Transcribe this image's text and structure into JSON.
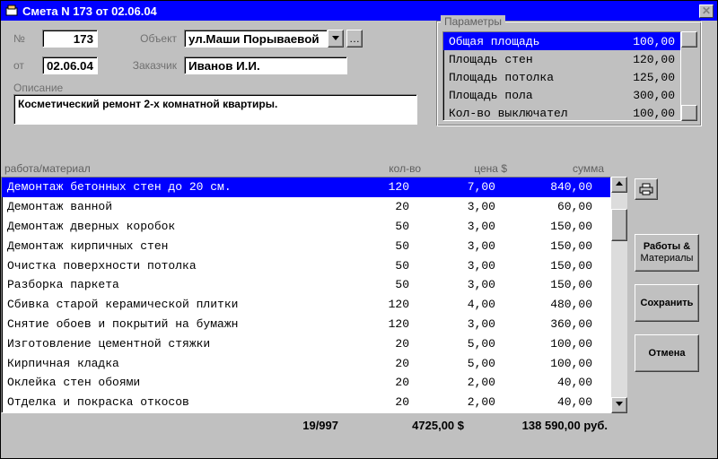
{
  "window": {
    "title": "Смета N 173 от 02.06.04"
  },
  "header": {
    "number_label": "№",
    "number_value": "173",
    "date_label": "от",
    "date_value": "02.06.04",
    "object_label": "Объект",
    "object_value": "ул.Маши Порываевой",
    "customer_label": "Заказчик",
    "customer_value": "Иванов И.И.",
    "descr_label": "Описание",
    "descr_value": "Косметический ремонт 2-х комнатной квартиры."
  },
  "params": {
    "group_title": "Параметры",
    "selected": 0,
    "items": [
      {
        "name": "Общая площадь",
        "value": "100,00"
      },
      {
        "name": "Площадь стен",
        "value": "120,00"
      },
      {
        "name": "Площадь потолка",
        "value": "125,00"
      },
      {
        "name": "Площадь пола",
        "value": "300,00"
      },
      {
        "name": "Кол-во выключател",
        "value": "100,00"
      }
    ]
  },
  "grid": {
    "col_work": "работа/материал",
    "col_qty": "кол-во",
    "col_price": "цена $",
    "col_sum": "сумма",
    "selected": 0,
    "rows": [
      {
        "name": "Демонтаж бетонных стен до 20 см.",
        "qty": "120",
        "price": "7,00",
        "sum": "840,00"
      },
      {
        "name": "Демонтаж ванной",
        "qty": "20",
        "price": "3,00",
        "sum": "60,00"
      },
      {
        "name": "Демонтаж дверных коробок",
        "qty": "50",
        "price": "3,00",
        "sum": "150,00"
      },
      {
        "name": "Демонтаж кирпичных стен",
        "qty": "50",
        "price": "3,00",
        "sum": "150,00"
      },
      {
        "name": "Очистка поверхности потолка",
        "qty": "50",
        "price": "3,00",
        "sum": "150,00"
      },
      {
        "name": "Разборка паркета",
        "qty": "50",
        "price": "3,00",
        "sum": "150,00"
      },
      {
        "name": "Сбивка старой керамической плитки",
        "qty": "120",
        "price": "4,00",
        "sum": "480,00"
      },
      {
        "name": "Снятие обоев и покрытий на бумажн",
        "qty": "120",
        "price": "3,00",
        "sum": "360,00"
      },
      {
        "name": "Изготовление цементной стяжки",
        "qty": "20",
        "price": "5,00",
        "sum": "100,00"
      },
      {
        "name": "Кирпичная кладка",
        "qty": "20",
        "price": "5,00",
        "sum": "100,00"
      },
      {
        "name": "Оклейка стен обоями",
        "qty": "20",
        "price": "2,00",
        "sum": "40,00"
      },
      {
        "name": "Отделка и покраска откосов",
        "qty": "20",
        "price": "2,00",
        "sum": "40,00"
      }
    ]
  },
  "totals": {
    "count": "19/997",
    "price_sum": "4725,00 $",
    "total_sum": "138 590,00 руб."
  },
  "buttons": {
    "works_line1": "Работы &",
    "works_line2": "Материалы",
    "save": "Сохранить",
    "cancel": "Отмена"
  }
}
